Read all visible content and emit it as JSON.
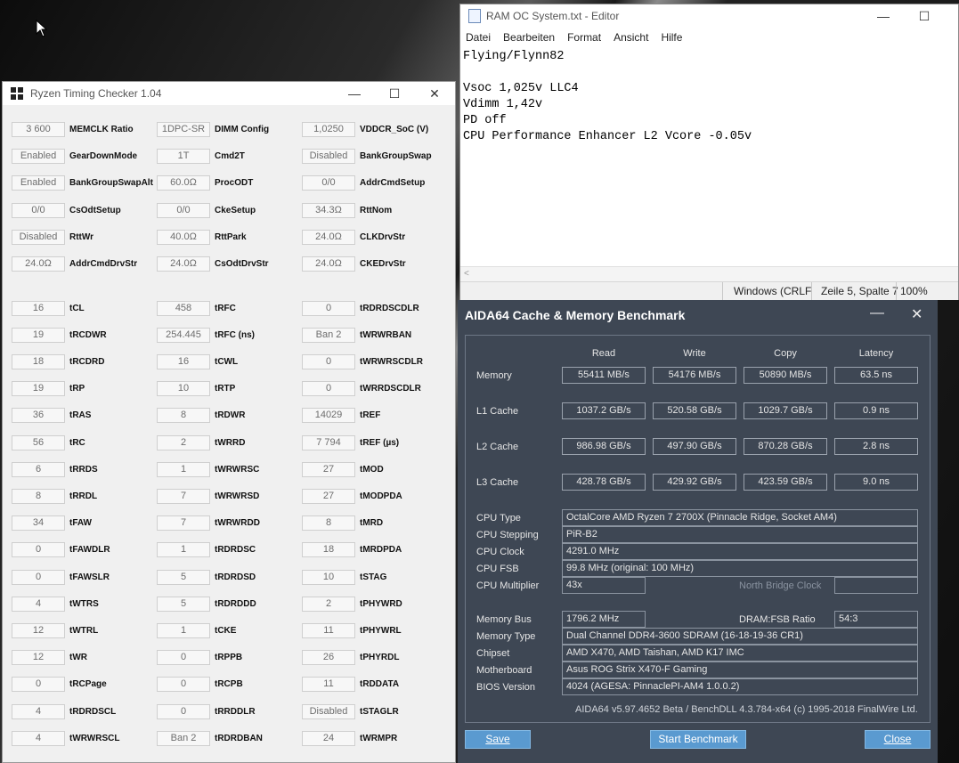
{
  "rtc": {
    "title": "Ryzen Timing Checker 1.04",
    "rows": [
      [
        [
          "3 600",
          "MEMCLK Ratio"
        ],
        [
          "1DPC-SR",
          "DIMM Config"
        ],
        [
          "1,0250",
          "VDDCR_SoC (V)"
        ]
      ],
      [
        [
          "Enabled",
          "GearDownMode"
        ],
        [
          "1T",
          "Cmd2T"
        ],
        [
          "Disabled",
          "BankGroupSwap"
        ]
      ],
      [
        [
          "Enabled",
          "BankGroupSwapAlt"
        ],
        [
          "60.0Ω",
          "ProcODT"
        ],
        [
          "0/0",
          "AddrCmdSetup"
        ]
      ],
      [
        [
          "0/0",
          "CsOdtSetup"
        ],
        [
          "0/0",
          "CkeSetup"
        ],
        [
          "34.3Ω",
          "RttNom"
        ]
      ],
      [
        [
          "Disabled",
          "RttWr"
        ],
        [
          "40.0Ω",
          "RttPark"
        ],
        [
          "24.0Ω",
          "CLKDrvStr"
        ]
      ],
      [
        [
          "24.0Ω",
          "AddrCmdDrvStr"
        ],
        [
          "24.0Ω",
          "CsOdtDrvStr"
        ],
        [
          "24.0Ω",
          "CKEDrvStr"
        ]
      ],
      [
        [
          "16",
          "tCL"
        ],
        [
          "458",
          "tRFC"
        ],
        [
          "0",
          "tRDRDSCDLR"
        ]
      ],
      [
        [
          "19",
          "tRCDWR"
        ],
        [
          "254.445",
          "tRFC (ns)"
        ],
        [
          "Ban 2",
          "tWRWRBAN"
        ]
      ],
      [
        [
          "18",
          "tRCDRD"
        ],
        [
          "16",
          "tCWL"
        ],
        [
          "0",
          "tWRWRSCDLR"
        ]
      ],
      [
        [
          "19",
          "tRP"
        ],
        [
          "10",
          "tRTP"
        ],
        [
          "0",
          "tWRRDSCDLR"
        ]
      ],
      [
        [
          "36",
          "tRAS"
        ],
        [
          "8",
          "tRDWR"
        ],
        [
          "14029",
          "tREF"
        ]
      ],
      [
        [
          "56",
          "tRC"
        ],
        [
          "2",
          "tWRRD"
        ],
        [
          "7 794",
          "tREF (µs)"
        ]
      ],
      [
        [
          "6",
          "tRRDS"
        ],
        [
          "1",
          "tWRWRSC"
        ],
        [
          "27",
          "tMOD"
        ]
      ],
      [
        [
          "8",
          "tRRDL"
        ],
        [
          "7",
          "tWRWRSD"
        ],
        [
          "27",
          "tMODPDA"
        ]
      ],
      [
        [
          "34",
          "tFAW"
        ],
        [
          "7",
          "tWRWRDD"
        ],
        [
          "8",
          "tMRD"
        ]
      ],
      [
        [
          "0",
          "tFAWDLR"
        ],
        [
          "1",
          "tRDRDSC"
        ],
        [
          "18",
          "tMRDPDA"
        ]
      ],
      [
        [
          "0",
          "tFAWSLR"
        ],
        [
          "5",
          "tRDRDSD"
        ],
        [
          "10",
          "tSTAG"
        ]
      ],
      [
        [
          "4",
          "tWTRS"
        ],
        [
          "5",
          "tRDRDDD"
        ],
        [
          "2",
          "tPHYWRD"
        ]
      ],
      [
        [
          "12",
          "tWTRL"
        ],
        [
          "1",
          "tCKE"
        ],
        [
          "11",
          "tPHYWRL"
        ]
      ],
      [
        [
          "12",
          "tWR"
        ],
        [
          "0",
          "tRPPB"
        ],
        [
          "26",
          "tPHYRDL"
        ]
      ],
      [
        [
          "0",
          "tRCPage"
        ],
        [
          "0",
          "tRCPB"
        ],
        [
          "11",
          "tRDDATA"
        ]
      ],
      [
        [
          "4",
          "tRDRDSCL"
        ],
        [
          "0",
          "tRRDDLR"
        ],
        [
          "Disabled",
          "tSTAGLR"
        ]
      ],
      [
        [
          "4",
          "tWRWRSCL"
        ],
        [
          "Ban 2",
          "tRDRDBAN"
        ],
        [
          "24",
          "tWRMPR"
        ]
      ]
    ]
  },
  "editor": {
    "title": "RAM OC System.txt - Editor",
    "menu": [
      "Datei",
      "Bearbeiten",
      "Format",
      "Ansicht",
      "Hilfe"
    ],
    "lines": [
      "Flying/Flynn82",
      "",
      "Vsoc 1,025v LLC4",
      "Vdimm 1,42v",
      "PD off",
      "CPU Performance Enhancer L2 Vcore -0.05v"
    ],
    "status": {
      "encoding": "Windows (CRLF",
      "position": "Zeile 5, Spalte 7",
      "zoom": "100%"
    }
  },
  "aida": {
    "title": "AIDA64 Cache & Memory Benchmark",
    "headers": [
      "Read",
      "Write",
      "Copy",
      "Latency"
    ],
    "bench": [
      {
        "label": "Memory",
        "values": [
          "55411 MB/s",
          "54176 MB/s",
          "50890 MB/s",
          "63.5 ns"
        ]
      },
      {
        "label": "L1 Cache",
        "values": [
          "1037.2 GB/s",
          "520.58 GB/s",
          "1029.7 GB/s",
          "0.9 ns"
        ]
      },
      {
        "label": "L2 Cache",
        "values": [
          "986.98 GB/s",
          "497.90 GB/s",
          "870.28 GB/s",
          "2.8 ns"
        ]
      },
      {
        "label": "L3 Cache",
        "values": [
          "428.78 GB/s",
          "429.92 GB/s",
          "423.59 GB/s",
          "9.0 ns"
        ]
      }
    ],
    "cpu_type_label": "CPU Type",
    "cpu_type": "OctalCore AMD Ryzen 7 2700X  (Pinnacle Ridge, Socket AM4)",
    "cpu_stepping_label": "CPU Stepping",
    "cpu_stepping": "PiR-B2",
    "cpu_clock_label": "CPU Clock",
    "cpu_clock": "4291.0 MHz",
    "cpu_fsb_label": "CPU FSB",
    "cpu_fsb": "99.8 MHz  (original: 100 MHz)",
    "cpu_mult_label": "CPU Multiplier",
    "cpu_mult": "43x",
    "nb_clock_label": "North Bridge Clock",
    "nb_clock": "",
    "mem_bus_label": "Memory Bus",
    "mem_bus": "1796.2 MHz",
    "dram_fsb_label": "DRAM:FSB Ratio",
    "dram_fsb": "54:3",
    "mem_type_label": "Memory Type",
    "mem_type": "Dual Channel DDR4-3600 SDRAM  (16-18-19-36 CR1)",
    "chipset_label": "Chipset",
    "chipset": "AMD X470, AMD Taishan, AMD K17 IMC",
    "mobo_label": "Motherboard",
    "mobo": "Asus ROG Strix X470-F Gaming",
    "bios_label": "BIOS Version",
    "bios": "4024  (AGESA: PinnaclePI-AM4 1.0.0.2)",
    "footer": "AIDA64 v5.97.4652 Beta / BenchDLL 4.3.784-x64  (c) 1995-2018 FinalWire Ltd.",
    "save_label": "Save",
    "start_label": "Start Benchmark",
    "close_label": "Close"
  }
}
